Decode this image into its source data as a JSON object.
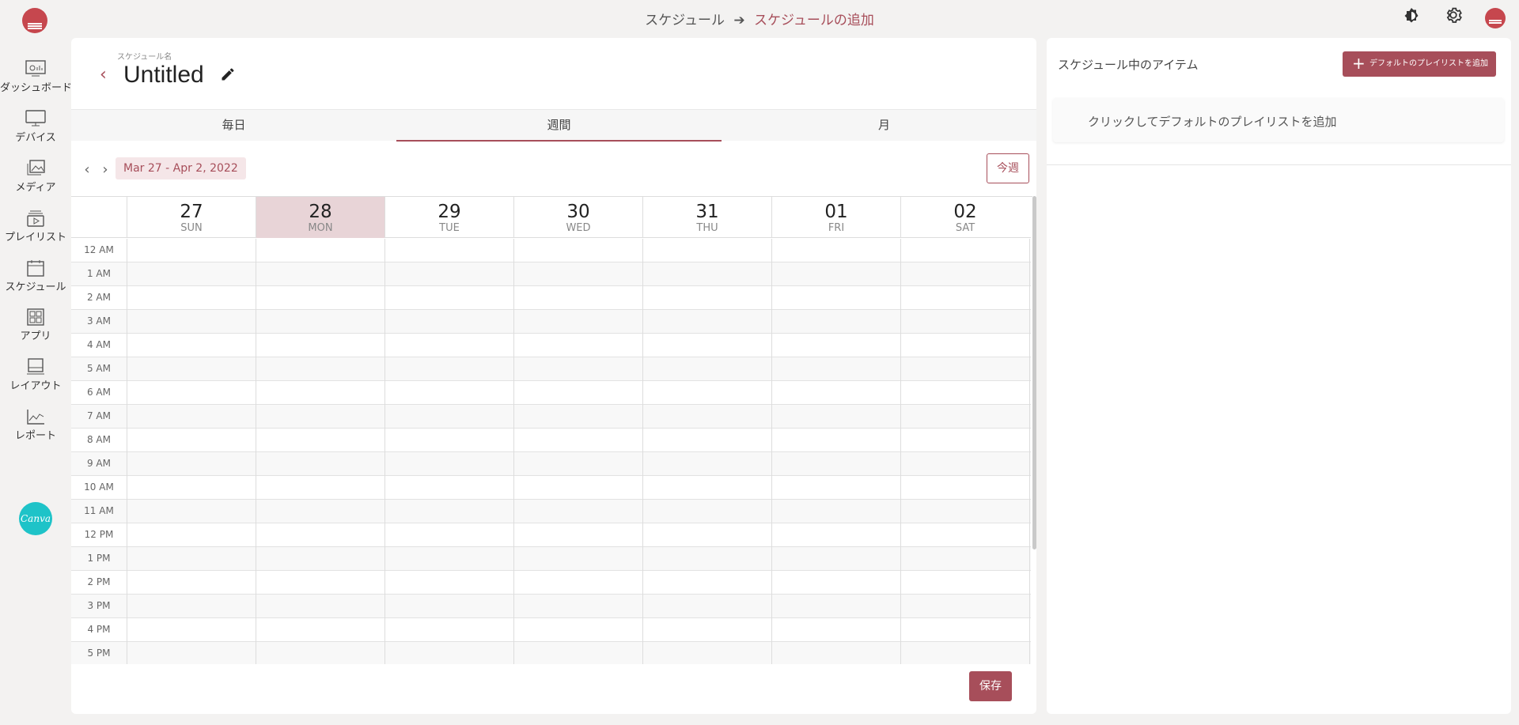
{
  "header": {
    "breadcrumb_root": "スケジュール",
    "breadcrumb_current": "スケジュールの追加"
  },
  "sidebar": {
    "items": [
      {
        "label": "ダッシュボード",
        "icon": "dashboard-icon"
      },
      {
        "label": "デバイス",
        "icon": "monitor-icon"
      },
      {
        "label": "メディア",
        "icon": "media-icon"
      },
      {
        "label": "プレイリスト",
        "icon": "playlist-icon"
      },
      {
        "label": "スケジュール",
        "icon": "calendar-icon"
      },
      {
        "label": "アプリ",
        "icon": "apps-icon"
      },
      {
        "label": "レイアウト",
        "icon": "layout-icon"
      },
      {
        "label": "レポート",
        "icon": "report-icon"
      }
    ],
    "canva_label": "Canva"
  },
  "editor": {
    "name_label": "スケジュール名",
    "title": "Untitled",
    "tabs": [
      "毎日",
      "週間",
      "月"
    ],
    "active_tab": "週間",
    "date_range": "Mar 27 - Apr 2, 2022",
    "today_button": "今週",
    "days": [
      {
        "num": "27",
        "name": "SUN",
        "highlight": false
      },
      {
        "num": "28",
        "name": "MON",
        "highlight": true
      },
      {
        "num": "29",
        "name": "TUE",
        "highlight": false
      },
      {
        "num": "30",
        "name": "WED",
        "highlight": false
      },
      {
        "num": "31",
        "name": "THU",
        "highlight": false
      },
      {
        "num": "01",
        "name": "FRI",
        "highlight": false
      },
      {
        "num": "02",
        "name": "SAT",
        "highlight": false
      }
    ],
    "hours": [
      "12 AM",
      "1 AM",
      "2 AM",
      "3 AM",
      "4 AM",
      "5 AM",
      "6 AM",
      "7 AM",
      "8 AM",
      "9 AM",
      "10 AM",
      "11 AM",
      "12 PM",
      "1 PM",
      "2 PM",
      "3 PM",
      "4 PM",
      "5 PM"
    ],
    "save_button": "保存"
  },
  "right_panel": {
    "title": "スケジュール中のアイテム",
    "add_default_button": "デフォルトのプレイリストを追加",
    "click_to_add": "クリックしてデフォルトのプレイリストを追加"
  },
  "colors": {
    "accent": "#a74e5a",
    "highlight_day": "#e8d4d7",
    "brand_logo": "#c6474e",
    "canva": "#1ec3c8"
  }
}
